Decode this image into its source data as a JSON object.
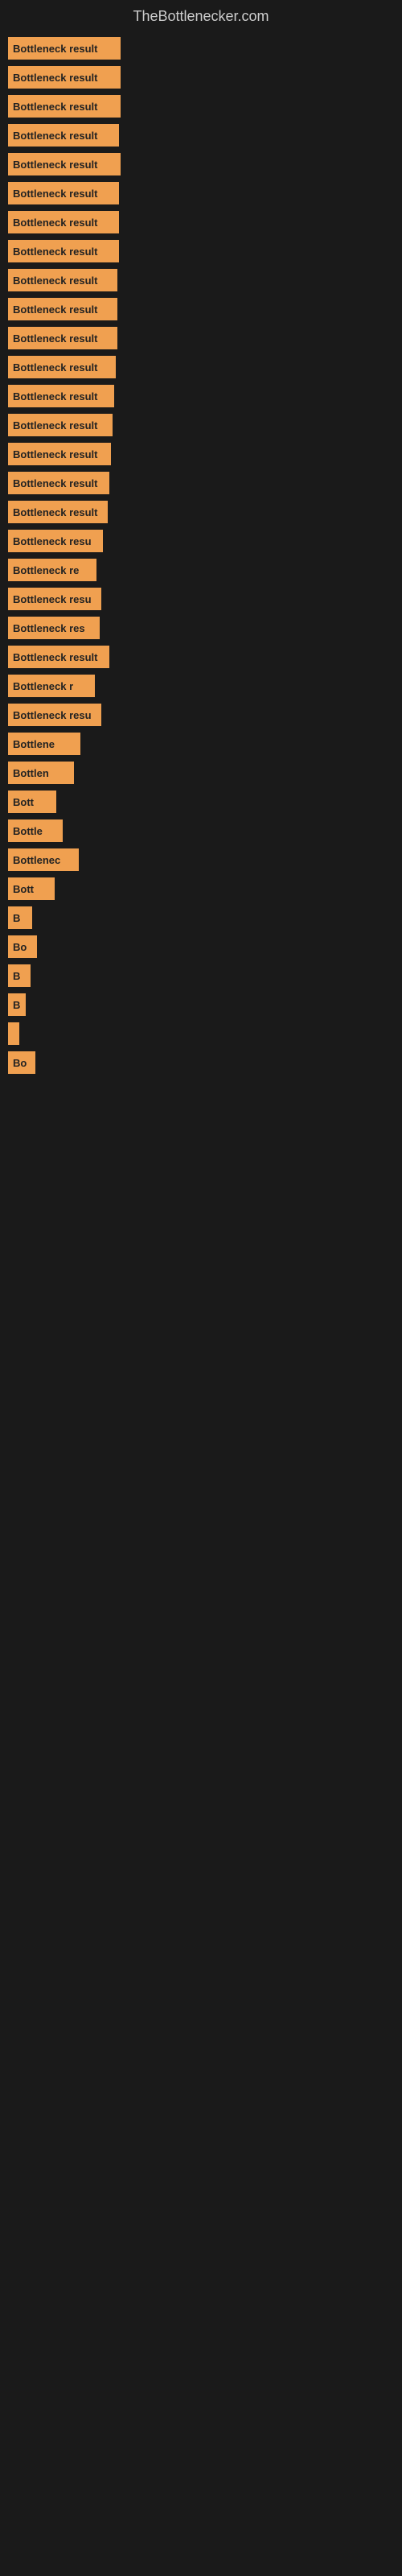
{
  "site": {
    "title": "TheBottlenecker.com"
  },
  "bars": [
    {
      "label": "Bottleneck result",
      "width": 140
    },
    {
      "label": "Bottleneck result",
      "width": 140
    },
    {
      "label": "Bottleneck result",
      "width": 140
    },
    {
      "label": "Bottleneck result",
      "width": 138
    },
    {
      "label": "Bottleneck result",
      "width": 140
    },
    {
      "label": "Bottleneck result",
      "width": 138
    },
    {
      "label": "Bottleneck result",
      "width": 138
    },
    {
      "label": "Bottleneck result",
      "width": 138
    },
    {
      "label": "Bottleneck result",
      "width": 136
    },
    {
      "label": "Bottleneck result",
      "width": 136
    },
    {
      "label": "Bottleneck result",
      "width": 136
    },
    {
      "label": "Bottleneck result",
      "width": 134
    },
    {
      "label": "Bottleneck result",
      "width": 132
    },
    {
      "label": "Bottleneck result",
      "width": 130
    },
    {
      "label": "Bottleneck result",
      "width": 128
    },
    {
      "label": "Bottleneck result",
      "width": 126
    },
    {
      "label": "Bottleneck result",
      "width": 124
    },
    {
      "label": "Bottleneck resu",
      "width": 118
    },
    {
      "label": "Bottleneck re",
      "width": 110
    },
    {
      "label": "Bottleneck resu",
      "width": 116
    },
    {
      "label": "Bottleneck res",
      "width": 114
    },
    {
      "label": "Bottleneck result",
      "width": 126
    },
    {
      "label": "Bottleneck r",
      "width": 108
    },
    {
      "label": "Bottleneck resu",
      "width": 116
    },
    {
      "label": "Bottlene",
      "width": 90
    },
    {
      "label": "Bottlen",
      "width": 82
    },
    {
      "label": "Bott",
      "width": 60
    },
    {
      "label": "Bottle",
      "width": 68
    },
    {
      "label": "Bottlenec",
      "width": 88
    },
    {
      "label": "Bott",
      "width": 58
    },
    {
      "label": "B",
      "width": 30
    },
    {
      "label": "Bo",
      "width": 36
    },
    {
      "label": "B",
      "width": 28
    },
    {
      "label": "B",
      "width": 22
    },
    {
      "label": "",
      "width": 14
    },
    {
      "label": "Bo",
      "width": 34
    }
  ]
}
